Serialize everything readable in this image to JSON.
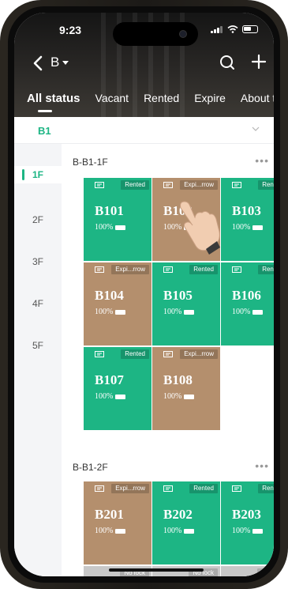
{
  "status_bar": {
    "time": "9:23"
  },
  "header": {
    "title": "B"
  },
  "tabs": [
    {
      "label": "All status"
    },
    {
      "label": "Vacant"
    },
    {
      "label": "Rented"
    },
    {
      "label": "Expire"
    },
    {
      "label": "About t"
    }
  ],
  "floor_selector": {
    "value": "B1"
  },
  "floors": [
    "1F",
    "2F",
    "3F",
    "4F",
    "5F"
  ],
  "sections": [
    {
      "title": "B-B1-1F",
      "more": "•••"
    },
    {
      "title": "B-B1-2F",
      "more": "•••"
    }
  ],
  "rooms_1f": [
    {
      "name": "B101",
      "status": "Rented",
      "battery": "100%",
      "color": "#1db584"
    },
    {
      "name": "B102",
      "status": "Expi...rrow",
      "battery": "100%",
      "color": "#b48f6d"
    },
    {
      "name": "B103",
      "status": "Rented",
      "battery": "100%",
      "color": "#1db584"
    },
    {
      "name": "B104",
      "status": "Expi...rrow",
      "battery": "100%",
      "color": "#b48f6d"
    },
    {
      "name": "B105",
      "status": "Rented",
      "battery": "100%",
      "color": "#1db584"
    },
    {
      "name": "B106",
      "status": "Rented",
      "battery": "100%",
      "color": "#1db584"
    },
    {
      "name": "B107",
      "status": "Rented",
      "battery": "100%",
      "color": "#1db584"
    },
    {
      "name": "B108",
      "status": "Expi...rrow",
      "battery": "100%",
      "color": "#b48f6d"
    }
  ],
  "rooms_2f": [
    {
      "name": "B201",
      "status": "Expi...rrow",
      "battery": "100%",
      "color": "#b48f6d"
    },
    {
      "name": "B202",
      "status": "Rented",
      "battery": "100%",
      "color": "#1db584"
    },
    {
      "name": "B203",
      "status": "Rented",
      "battery": "100%",
      "color": "#1db584"
    }
  ],
  "rooms_2f_row2": [
    {
      "status": "No lock"
    },
    {
      "status": "No lock"
    },
    {
      "status": "No lock"
    }
  ],
  "colors": {
    "accent": "#1db584",
    "rented": "#1db584",
    "expiring": "#b48f6d",
    "no_lock": "#c8c8c8"
  }
}
